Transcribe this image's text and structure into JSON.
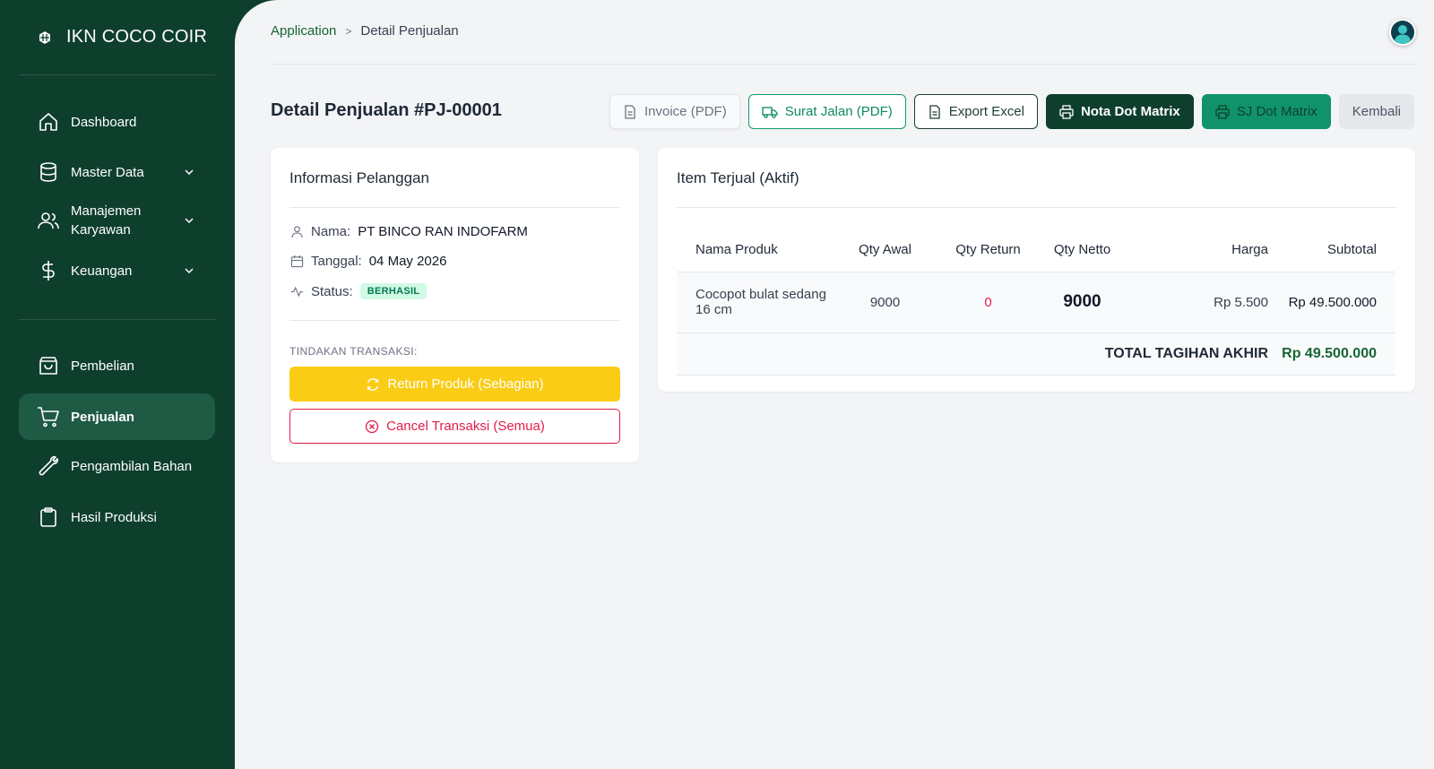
{
  "brand": {
    "name": "IKN COCO COIR",
    "logo_icon": "hexagon-logo-icon"
  },
  "sidebar": {
    "items": [
      {
        "label": "Dashboard",
        "icon": "home-icon",
        "has_submenu": false,
        "active": false
      },
      {
        "label": "Master Data",
        "icon": "database-icon",
        "has_submenu": true,
        "active": false
      },
      {
        "label": "Manajemen Karyawan",
        "icon": "users-icon",
        "has_submenu": true,
        "active": false
      },
      {
        "label": "Keuangan",
        "icon": "dollar-icon",
        "has_submenu": true,
        "active": false
      },
      {
        "label": "Pembelian",
        "icon": "shopping-bag-icon",
        "has_submenu": false,
        "active": false
      },
      {
        "label": "Penjualan",
        "icon": "cart-icon",
        "has_submenu": false,
        "active": true
      },
      {
        "label": "Pengambilan Bahan",
        "icon": "wrench-icon",
        "has_submenu": false,
        "active": false
      },
      {
        "label": "Hasil Produksi",
        "icon": "clipboard-icon",
        "has_submenu": false,
        "active": false
      }
    ]
  },
  "breadcrumb": {
    "root": "Application",
    "separator": ">",
    "current": "Detail Penjualan"
  },
  "page": {
    "title": "Detail Penjualan #PJ-00001"
  },
  "actions": {
    "invoice_pdf": "Invoice (PDF)",
    "surat_jalan_pdf": "Surat Jalan (PDF)",
    "export_excel": "Export Excel",
    "nota_dot_matrix": "Nota Dot Matrix",
    "sj_dot_matrix": "SJ Dot Matrix",
    "kembali": "Kembali"
  },
  "customer": {
    "title": "Informasi Pelanggan",
    "name_label": "Nama:",
    "name_value": "PT BINCO RAN INDOFARM",
    "date_label": "Tanggal:",
    "date_value": "04 May 2026",
    "status_label": "Status:",
    "status_value": "BERHASIL",
    "actions_label": "TINDAKAN TRANSAKSI:",
    "return_button": "Return Produk (Sebagian)",
    "cancel_button": "Cancel Transaksi (Semua)"
  },
  "items": {
    "title": "Item Terjual (Aktif)",
    "columns": [
      "Nama Produk",
      "Qty Awal",
      "Qty Return",
      "Qty Netto",
      "Harga",
      "Subtotal"
    ],
    "rows": [
      {
        "name": "Cocopot bulat sedang 16 cm",
        "qty_awal": "9000",
        "qty_return": "0",
        "qty_netto": "9000",
        "harga": "Rp 5.500",
        "subtotal": "Rp 49.500.000"
      }
    ],
    "total_label": "TOTAL TAGIHAN AKHIR",
    "total_value": "Rp 49.500.000"
  },
  "colors": {
    "sidebar_bg": "#0e3f2d",
    "accent_green": "#10936a",
    "warning_yellow": "#facc15",
    "danger_red": "#e11d48"
  }
}
